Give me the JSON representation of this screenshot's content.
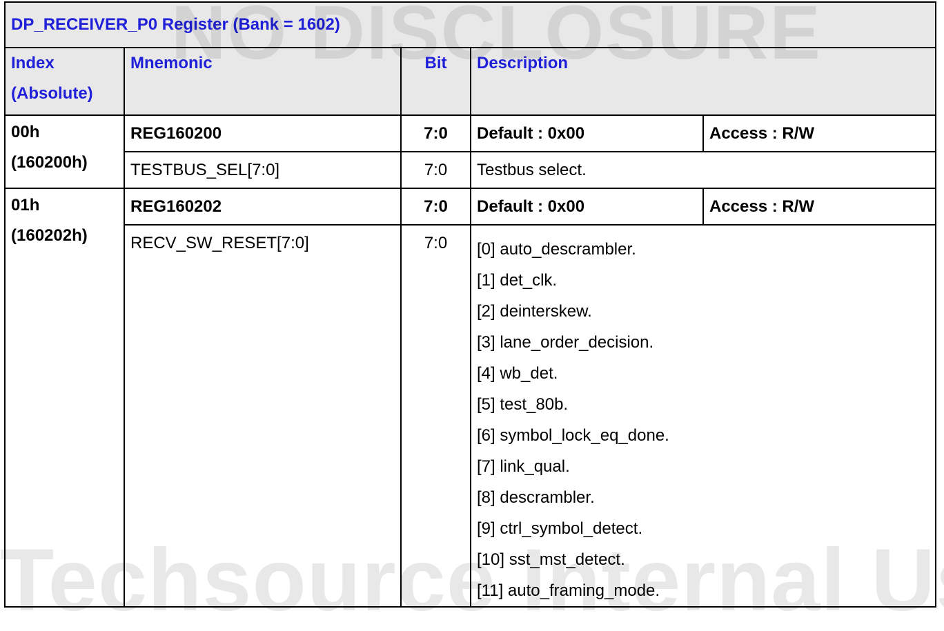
{
  "table": {
    "title": "DP_RECEIVER_P0 Register (Bank = 1602)",
    "headers": {
      "index_line1": "Index",
      "index_line2": "(Absolute)",
      "mnemonic": "Mnemonic",
      "bit": "Bit",
      "description": "Description"
    },
    "registers": [
      {
        "index": "00h",
        "absolute": "(160200h)",
        "name": "REG160200",
        "bits": "7:0",
        "default": "Default : 0x00",
        "access": "Access : R/W",
        "field": "TESTBUS_SEL[7:0]",
        "field_bits": "7:0",
        "field_desc": "Testbus select."
      },
      {
        "index": "01h",
        "absolute": "(160202h)",
        "name": "REG160202",
        "bits": "7:0",
        "default": "Default : 0x00",
        "access": "Access : R/W",
        "field": "RECV_SW_RESET[7:0]",
        "field_bits": "7:0",
        "field_desc_lines": [
          "[0] auto_descrambler.",
          "[1] det_clk.",
          "[2] deinterskew.",
          "[3] lane_order_decision.",
          "[4] wb_det.",
          "[5] test_80b.",
          "[6] symbol_lock_eq_done.",
          "[7] link_qual.",
          "[8] descrambler.",
          "[9] ctrl_symbol_detect.",
          "[10] sst_mst_detect.",
          "[11] auto_framing_mode."
        ]
      }
    ]
  },
  "watermarks": {
    "top": "NO DISCLOSURE",
    "bottom": "Techsource Internal Use"
  },
  "colors": {
    "header_text": "#2020d8",
    "header_bg": "#e8e8e8"
  }
}
